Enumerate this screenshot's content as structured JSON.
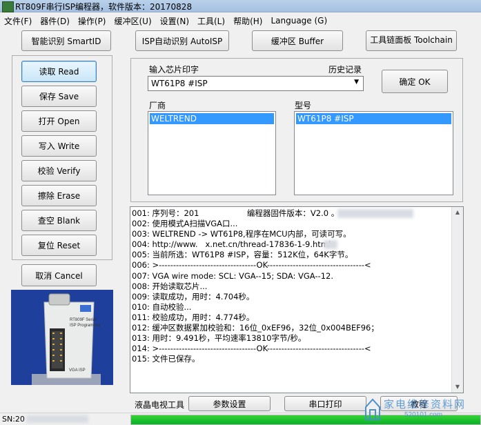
{
  "window": {
    "title": "RT809F串行ISP编程器，软件版本：20170828"
  },
  "menu": [
    "文件(F)",
    "器件(D)",
    "操作(P)",
    "缓冲区(U)",
    "设置(N)",
    "工具(L)",
    "帮助(H)",
    "Language (G)"
  ],
  "toolbar": {
    "smart_id": "智能识别 SmartID",
    "auto_isp": "ISP自动识别 AutoISP",
    "buffer": "缓冲区 Buffer",
    "toolchain": "工具链面板 Toolchain"
  },
  "actions": [
    {
      "label": "读取 Read"
    },
    {
      "label": "保存 Save"
    },
    {
      "label": "打开 Open"
    },
    {
      "label": "写入 Write"
    },
    {
      "label": "校验 Verify"
    },
    {
      "label": "擦除 Erase"
    },
    {
      "label": "查空 Blank"
    },
    {
      "label": "复位 Reset"
    }
  ],
  "cancel_label": "取消 Cancel",
  "chip": {
    "input_label": "输入芯片印字",
    "history_label": "历史记录",
    "input_value": "WT61P8 #ISP",
    "ok_label": "确定 OK",
    "vendor_label": "厂商",
    "model_label": "型号",
    "vendor_selected": "WELTREND",
    "model_selected": "WT61P8 #ISP"
  },
  "device_image": {
    "top_label": "RT809F Serial",
    "bottom_label": "ISP Programmer",
    "port_label": "VGA ISP"
  },
  "log": [
    "001: 序列号：201                   编程器固件版本：V2.0 。",
    "002: 使用模式A扫描VGA口...",
    "003: WELTREND -> WT61P8,程序在MCU内部，可读可写。",
    "004: http://www.   x.net.cn/thread-17836-1-9.html",
    "005: 当前所选：WT61P8 #ISP，容量：512K位，64K字节。",
    "006: >----------------------------------OK----------------------------------<",
    "007: VGA wire mode: SCL: VGA--15; SDA: VGA--12.",
    "008: 开始读取芯片...",
    "009: 读取成功，用时：4.704秒。",
    "010: 自动校验...",
    "011: 校验成功，用时：4.774秒。",
    "012: 缓冲区数据累加校验和：16位_0xEF96，32位_0x004BEF96；",
    "013: 用时：9.491秒，平均速率13810字节/秒。",
    "014: >----------------------------------OK----------------------------------<",
    "015: 文件已保存。"
  ],
  "bottom": {
    "tv_tools": "液晶电视工具",
    "params": "参数设置",
    "serial_print": "串口打印",
    "tutorial": "教程"
  },
  "status": {
    "sn_label": "SN:20",
    "progress": 1.0
  },
  "watermark": {
    "text": "家电维修资料网",
    "url": "520101.com"
  }
}
